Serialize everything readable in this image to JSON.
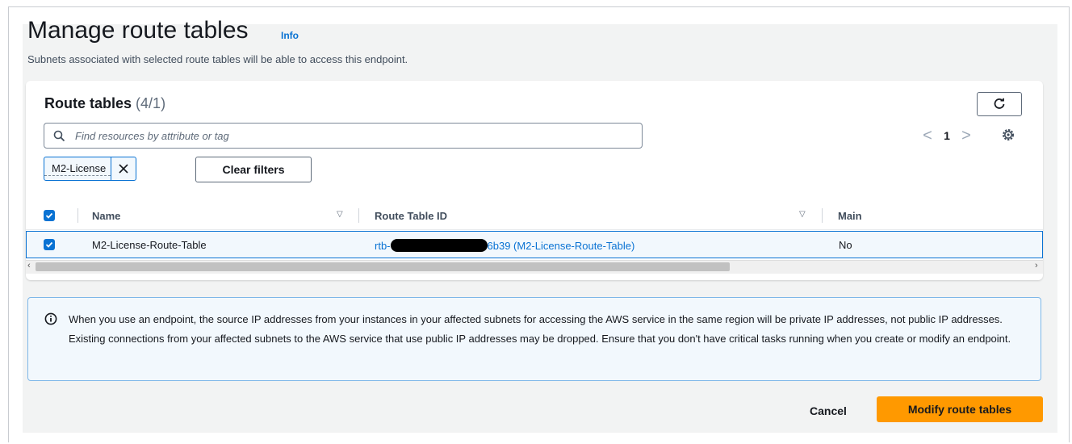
{
  "header": {
    "title": "Manage route tables",
    "info_label": "Info",
    "subtitle": "Subnets associated with selected route tables will be able to access this endpoint."
  },
  "route_tables": {
    "title": "Route tables",
    "count": "(4/1)",
    "search": {
      "placeholder": "Find resources by attribute or tag"
    },
    "pagination": {
      "prev": "<",
      "page": "1",
      "next": ">"
    },
    "filter_token": "M2-License",
    "clear_filters_label": "Clear filters",
    "columns": [
      "Name",
      "Route Table ID",
      "Main"
    ],
    "rows": [
      {
        "selected": true,
        "name": "M2-License-Route-Table",
        "id_prefix": "rtb-",
        "id_suffix": "6b39 (M2-License-Route-Table)",
        "main": "No"
      }
    ]
  },
  "alert": {
    "icon": "info-icon",
    "text": "When you use an endpoint, the source IP addresses from your instances in your affected subnets for accessing the AWS service in the same region will be private IP addresses, not public IP addresses. Existing connections from your affected subnets to the AWS service that use public IP addresses may be dropped. Ensure that you don't have critical tasks running when you create or modify an endpoint."
  },
  "footer": {
    "cancel_label": "Cancel",
    "primary_label": "Modify route tables"
  },
  "colors": {
    "accent": "#0972d3",
    "primary_button": "#ff9900",
    "alert_bg": "#f2f8fd"
  }
}
